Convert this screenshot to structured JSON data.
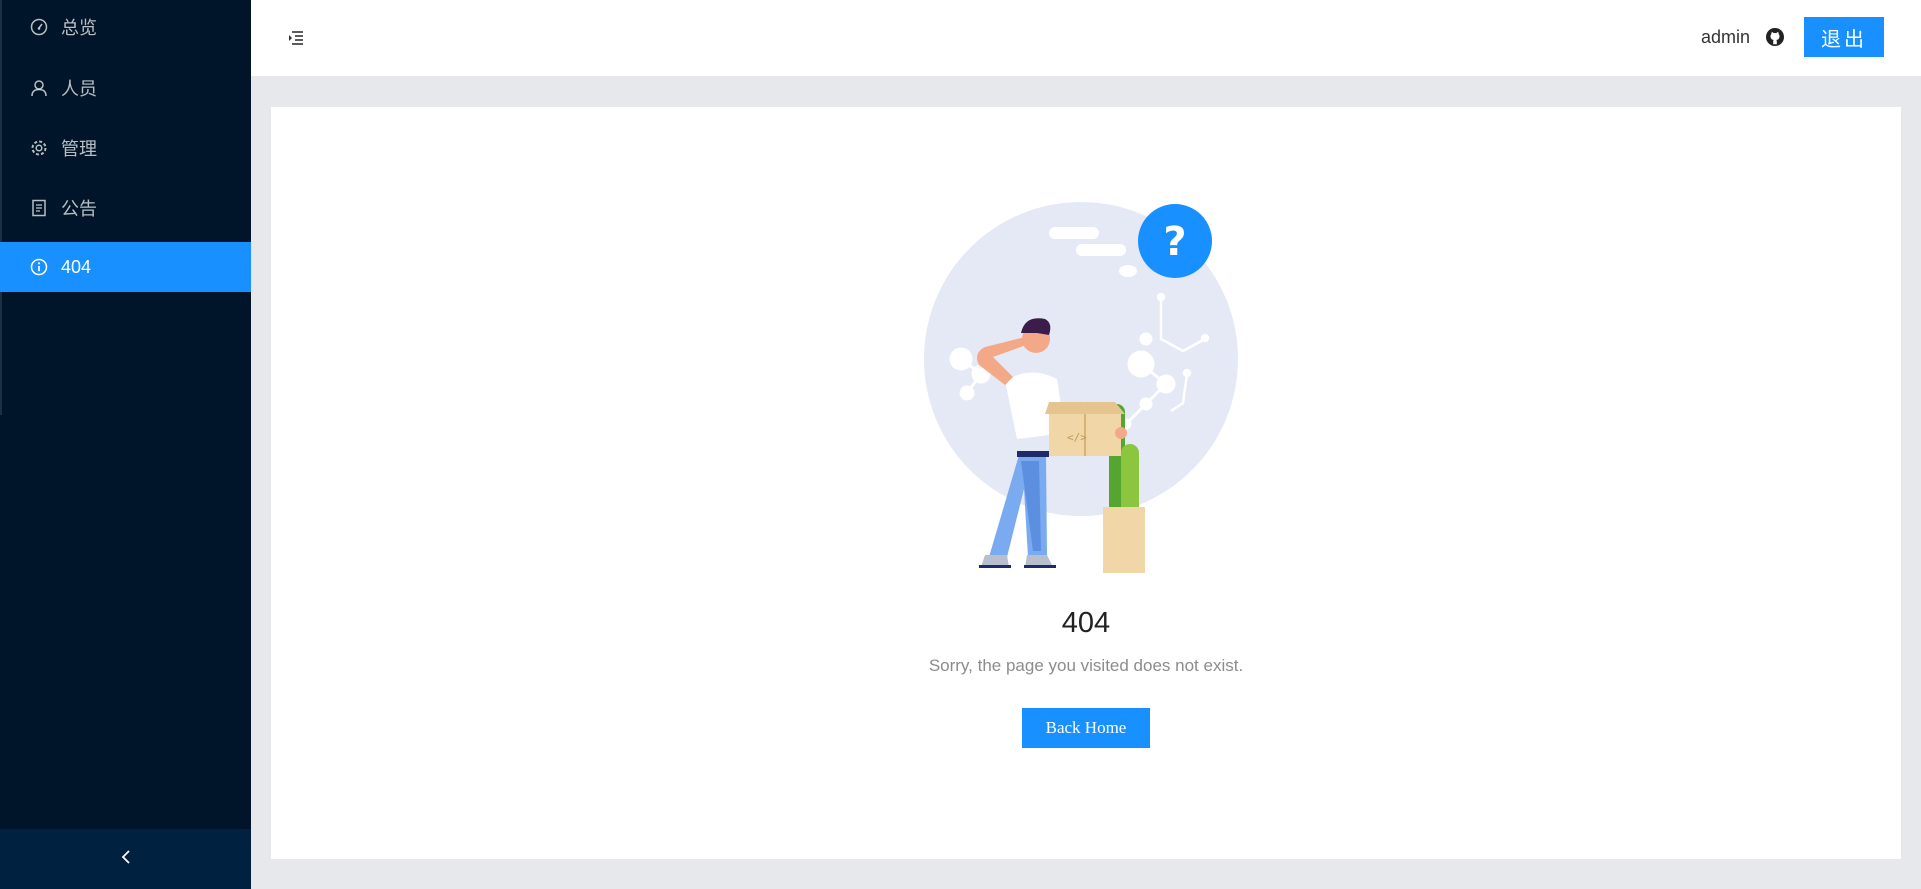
{
  "sidebar": {
    "items": [
      {
        "label": "总览",
        "icon": "dashboard-icon",
        "active": false
      },
      {
        "label": "人员",
        "icon": "user-icon",
        "active": false
      },
      {
        "label": "管理",
        "icon": "gear-icon",
        "active": false
      },
      {
        "label": "公告",
        "icon": "document-icon",
        "active": false
      },
      {
        "label": "404",
        "icon": "info-icon",
        "active": true
      }
    ],
    "collapse_icon": "chevron-left-icon"
  },
  "header": {
    "fold_icon": "menu-fold-icon",
    "username": "admin",
    "github_icon": "github-icon",
    "logout_label": "退出"
  },
  "result": {
    "title": "404",
    "subtitle": "Sorry, the page you visited does not exist.",
    "button_label": "Back Home",
    "illustration": "404-illustration"
  },
  "colors": {
    "sidebar_bg": "#001529",
    "accent": "#1890ff",
    "page_bg": "#e6e8ec"
  }
}
